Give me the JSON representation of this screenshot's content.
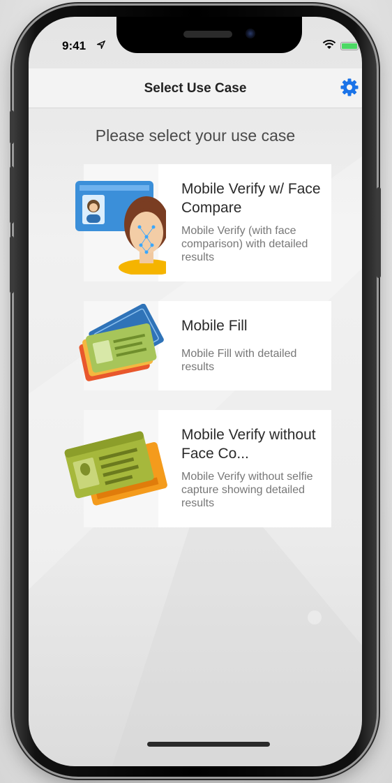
{
  "status_bar": {
    "time": "9:41",
    "location_icon": "location-arrow-icon",
    "wifi_icon": "wifi-icon",
    "battery_icon": "battery-charging-icon",
    "battery_color": "#4cd964"
  },
  "navbar": {
    "title": "Select Use Case",
    "settings_icon": "gear-icon",
    "accent_color": "#1a73e8"
  },
  "instruction": "Please select your use case",
  "use_cases": [
    {
      "title": "Mobile Verify w/ Face Compare",
      "description": "Mobile Verify (with face comparison) with detailed results",
      "icon": "id-card-face-icon"
    },
    {
      "title": "Mobile Fill",
      "description": "Mobile Fill with detailed results",
      "icon": "passport-id-cards-icon"
    },
    {
      "title": "Mobile Verify without Face Co...",
      "description": "Mobile Verify without selfie capture showing detailed results",
      "icon": "driver-license-cards-icon"
    }
  ]
}
